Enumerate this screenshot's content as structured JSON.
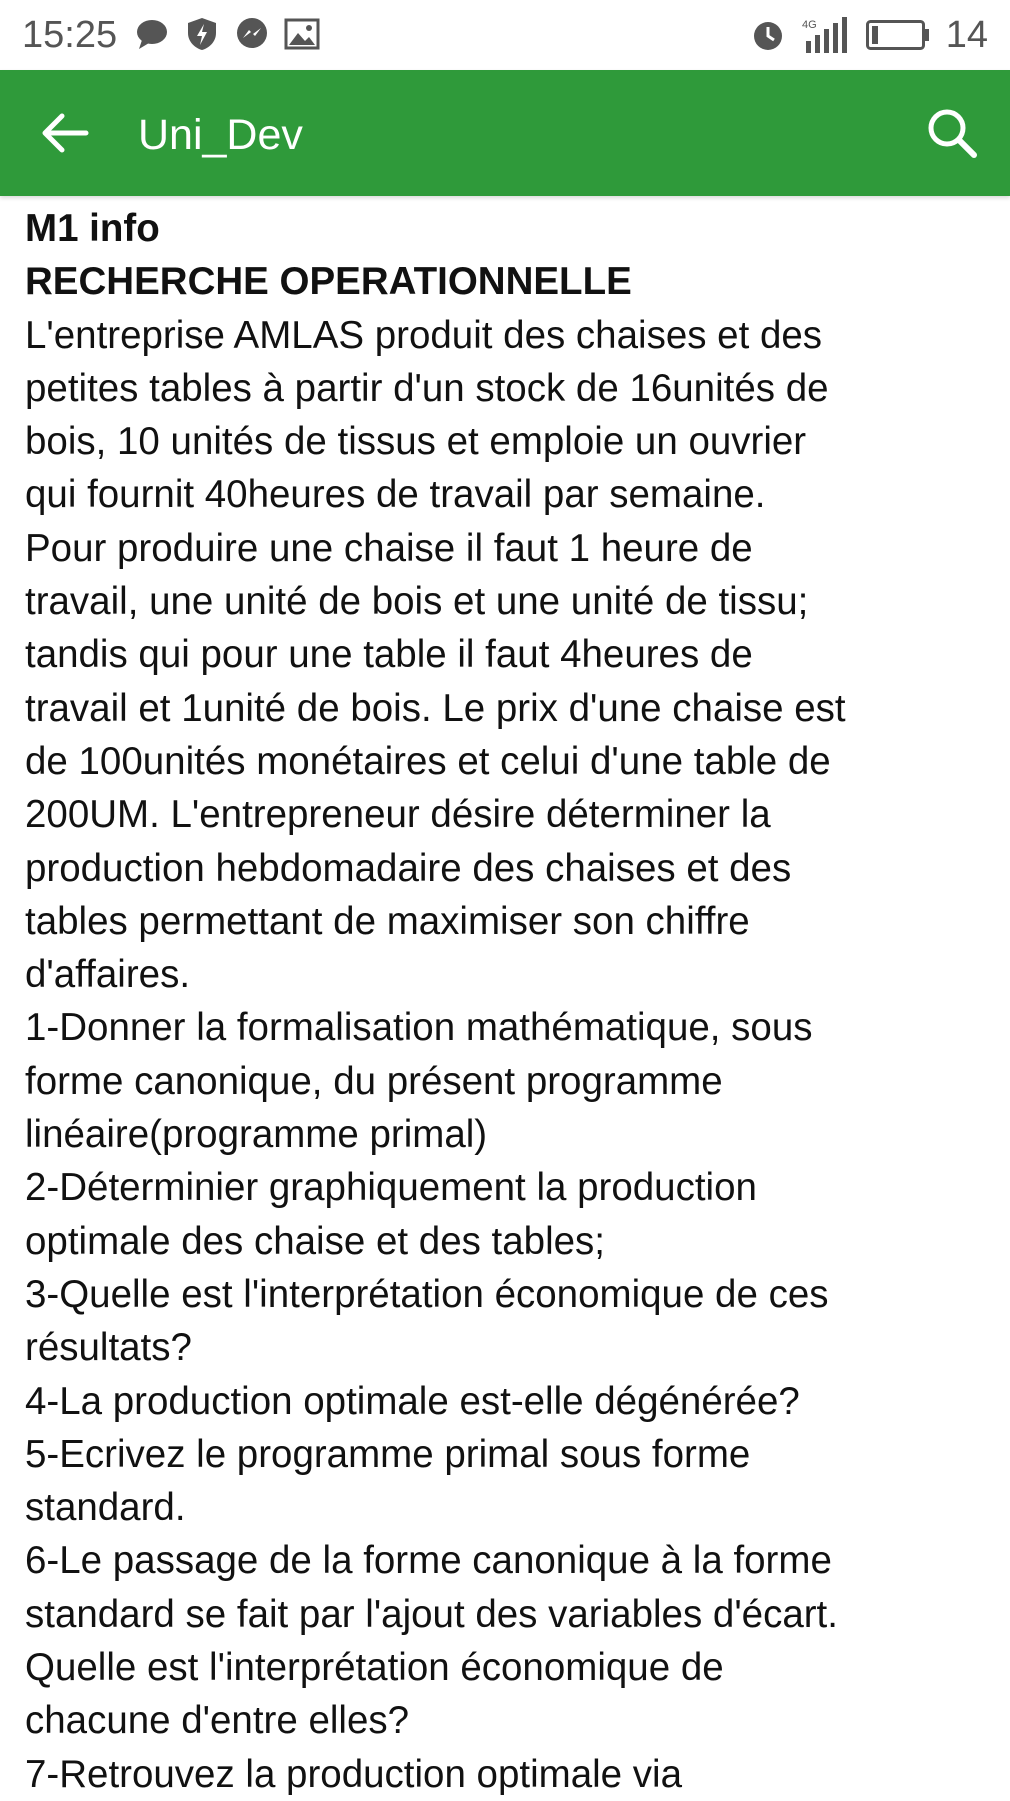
{
  "status_bar": {
    "time": "15:25",
    "left_icons": [
      "chat-bubble-icon",
      "shield-icon",
      "messenger-icon",
      "gallery-icon"
    ],
    "right_icons": [
      "alarm-icon",
      "signal-4g-icon",
      "battery-icon"
    ],
    "battery_level": "14"
  },
  "app_bar": {
    "title": "Uni_Dev",
    "back_icon": "arrow-left-icon",
    "search_icon": "search-icon",
    "color": "#2f9a3a"
  },
  "post": {
    "heading_1": "M1 info",
    "heading_2": "RECHERCHE OPERATIONNELLE",
    "lines": [
      "L'entreprise AMLAS produit des chaises et des",
      "petites tables à partir d'un stock de 16unités de",
      "bois, 10 unités de tissus et emploie un ouvrier",
      "qui fournit 40heures de travail par semaine.",
      "Pour produire une chaise il faut 1 heure de",
      "travail, une unité de bois et une unité de tissu;",
      "tandis qui pour une table il faut 4heures de",
      "travail et 1unité de bois. Le prix d'une chaise est",
      "de 100unités monétaires et celui d'une table de",
      "200UM. L'entrepreneur désire déterminer la",
      "production hebdomadaire des chaises et des",
      "tables permettant de maximiser son chiffre",
      "d'affaires.",
      "1-Donner la formalisation mathématique, sous",
      "forme canonique, du présent programme",
      "linéaire(programme primal)",
      "2-Déterminier graphiquement la production",
      "optimale des chaise et des tables;",
      "3-Quelle est l'interprétation économique de ces",
      "résultats?",
      "4-La production optimale est-elle dégénérée?",
      "5-Ecrivez le programme primal sous forme",
      "standard.",
      "6-Le passage de la forme canonique à la forme",
      "standard se fait par l'ajout des variables d'écart.",
      "Quelle est l'interprétation économique de",
      "chacune d'entre elles?",
      "7-Retrouvez la production optimale via"
    ]
  }
}
